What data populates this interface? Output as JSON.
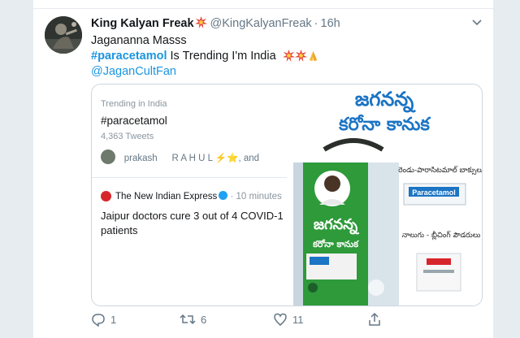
{
  "tweet": {
    "display_name": "King Kalyan Freak",
    "handle": "@KingKalyanFreak",
    "separator": "·",
    "time": "16h",
    "line1": "Jagananna Masss",
    "hashtag": "#paracetamol",
    "line2_rest": " Is Trending I'm India ",
    "mention": "@JaganCultFan"
  },
  "screenshot": {
    "trend_label": "Trending in India",
    "trend_hashtag": "#paracetamol",
    "tweet_count": "4,363 Tweets",
    "names_text": " prakash    R A H U L ⚡⭐, and",
    "news_source": "The New Indian Express",
    "news_meta": "· 10 minutes",
    "headline": "Jaipur doctors cure 3 out of 4 COVID-1 patients"
  },
  "poster": {
    "title_line1": "జగనన్న",
    "title_line2": "కరోనా కానుక",
    "bag_line1": "జగనన్న",
    "bag_line2": "కరోనా కానుక",
    "tablets_caption": "రెండు-పారాసిటమాల్ బాక్సులు",
    "box_label": "Paracetamol",
    "bleach_caption": "నాలుగు - బ్లీచింగ్ పౌడరులు",
    "colors": {
      "background": "#ffffff",
      "blue": "#1b74c4",
      "green": "#2e9a3a",
      "dark_green": "#1d5f2b"
    }
  },
  "actions": {
    "reply_count": "1",
    "retweet_count": "6",
    "like_count": "11"
  },
  "icons": [
    "burst-icon",
    "folded-hands-icon",
    "reply-icon",
    "retweet-icon",
    "like-icon",
    "share-icon",
    "verified-icon",
    "caret-down-icon"
  ]
}
